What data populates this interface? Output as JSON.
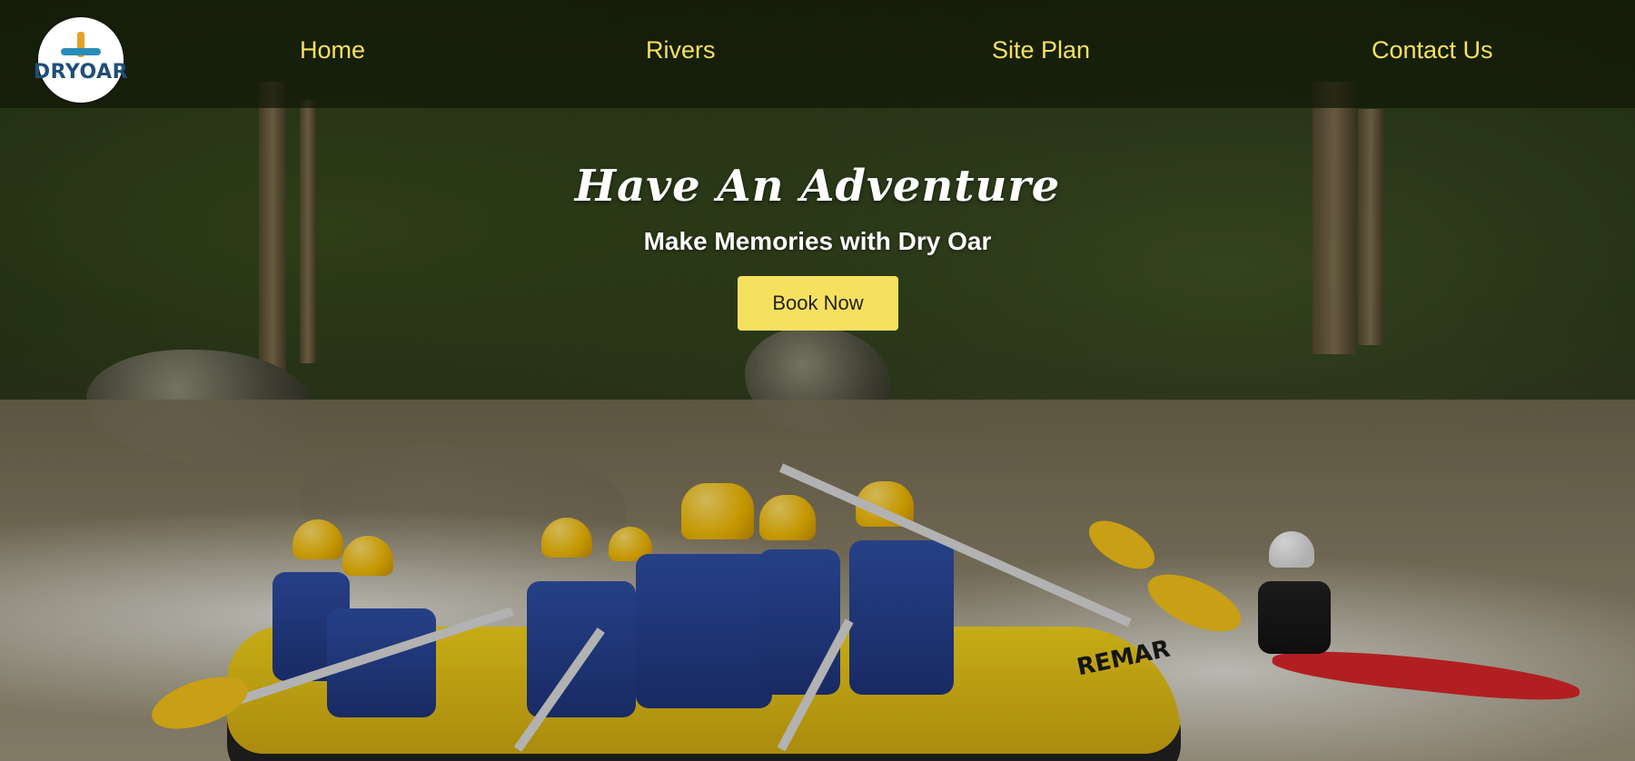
{
  "brand": {
    "logo_text": "DRYOAR"
  },
  "nav": {
    "items": [
      {
        "label": "Home"
      },
      {
        "label": "Rivers"
      },
      {
        "label": "Site Plan"
      },
      {
        "label": "Contact Us"
      }
    ]
  },
  "hero": {
    "title": "Have An Adventure",
    "subtitle": "Make Memories with Dry Oar",
    "cta_label": "Book Now",
    "image_text": "REMAR"
  },
  "colors": {
    "accent_yellow": "#f6e15f",
    "nav_background": "#101806",
    "text_white": "#ffffff"
  }
}
